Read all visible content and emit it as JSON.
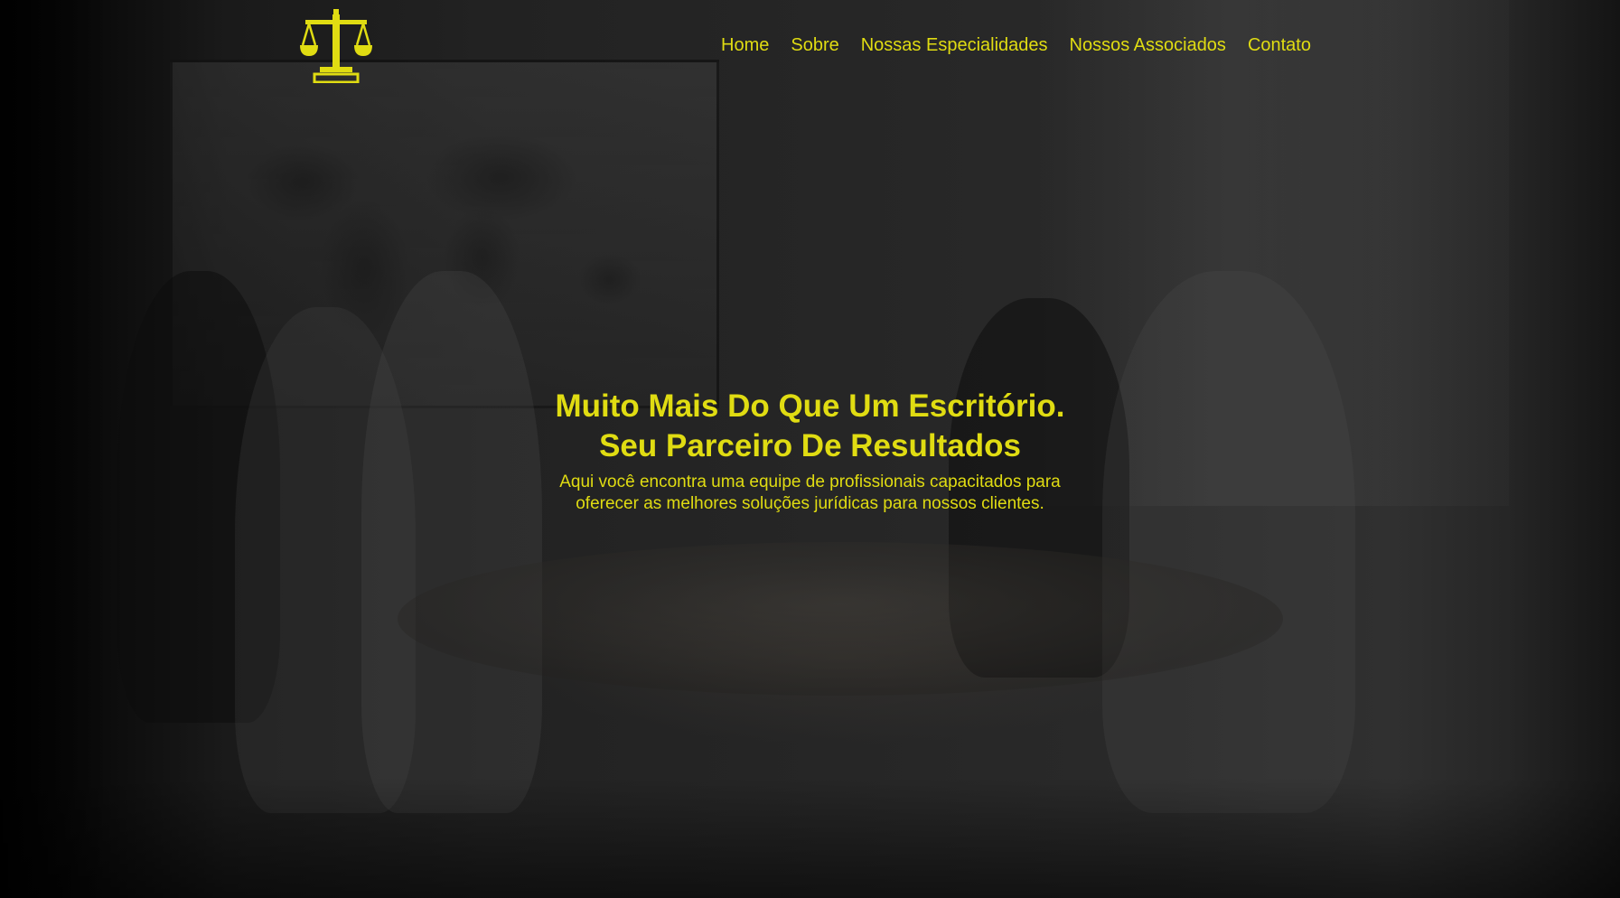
{
  "brand": {
    "logo_icon": "scales-of-justice-icon",
    "accent_color": "#e0dc12"
  },
  "nav": {
    "items": [
      {
        "label": "Home"
      },
      {
        "label": "Sobre"
      },
      {
        "label": "Nossas Especialidades"
      },
      {
        "label": "Nossos Associados"
      },
      {
        "label": "Contato"
      }
    ]
  },
  "hero": {
    "title_line1": "Muito Mais Do Que Um Escritório.",
    "title_line2": "Seu Parceiro De Resultados",
    "subtitle_line1": "Aqui você encontra uma equipe de profissionais capacitados para",
    "subtitle_line2": "oferecer as melhores soluções jurídicas para nossos clientes."
  }
}
